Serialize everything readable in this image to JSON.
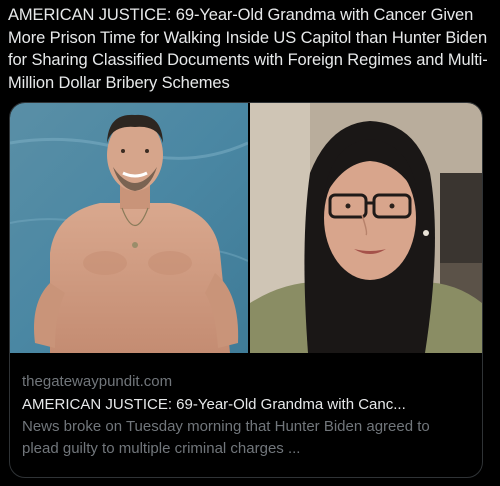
{
  "post": {
    "text": "AMERICAN JUSTICE: 69-Year-Old Grandma with Cancer Given More Prison Time for Walking Inside US Capitol than Hunter Biden for Sharing Classified Documents with Foreign Regimes and Multi-Million Dollar Bribery Schemes"
  },
  "card": {
    "domain": "thegatewaypundit.com",
    "title": "AMERICAN JUSTICE: 69-Year-Old Grandma with Canc...",
    "description": "News broke on Tuesday morning that Hunter Biden agreed to plead guilty to multiple criminal charges ...",
    "images": [
      {
        "name": "shirtless man in swimming pool"
      },
      {
        "name": "older woman with glasses and headscarf"
      }
    ]
  },
  "colors": {
    "background": "#000000",
    "text_primary": "#e7e9ea",
    "text_secondary": "#71767b",
    "border": "#2f3336"
  }
}
